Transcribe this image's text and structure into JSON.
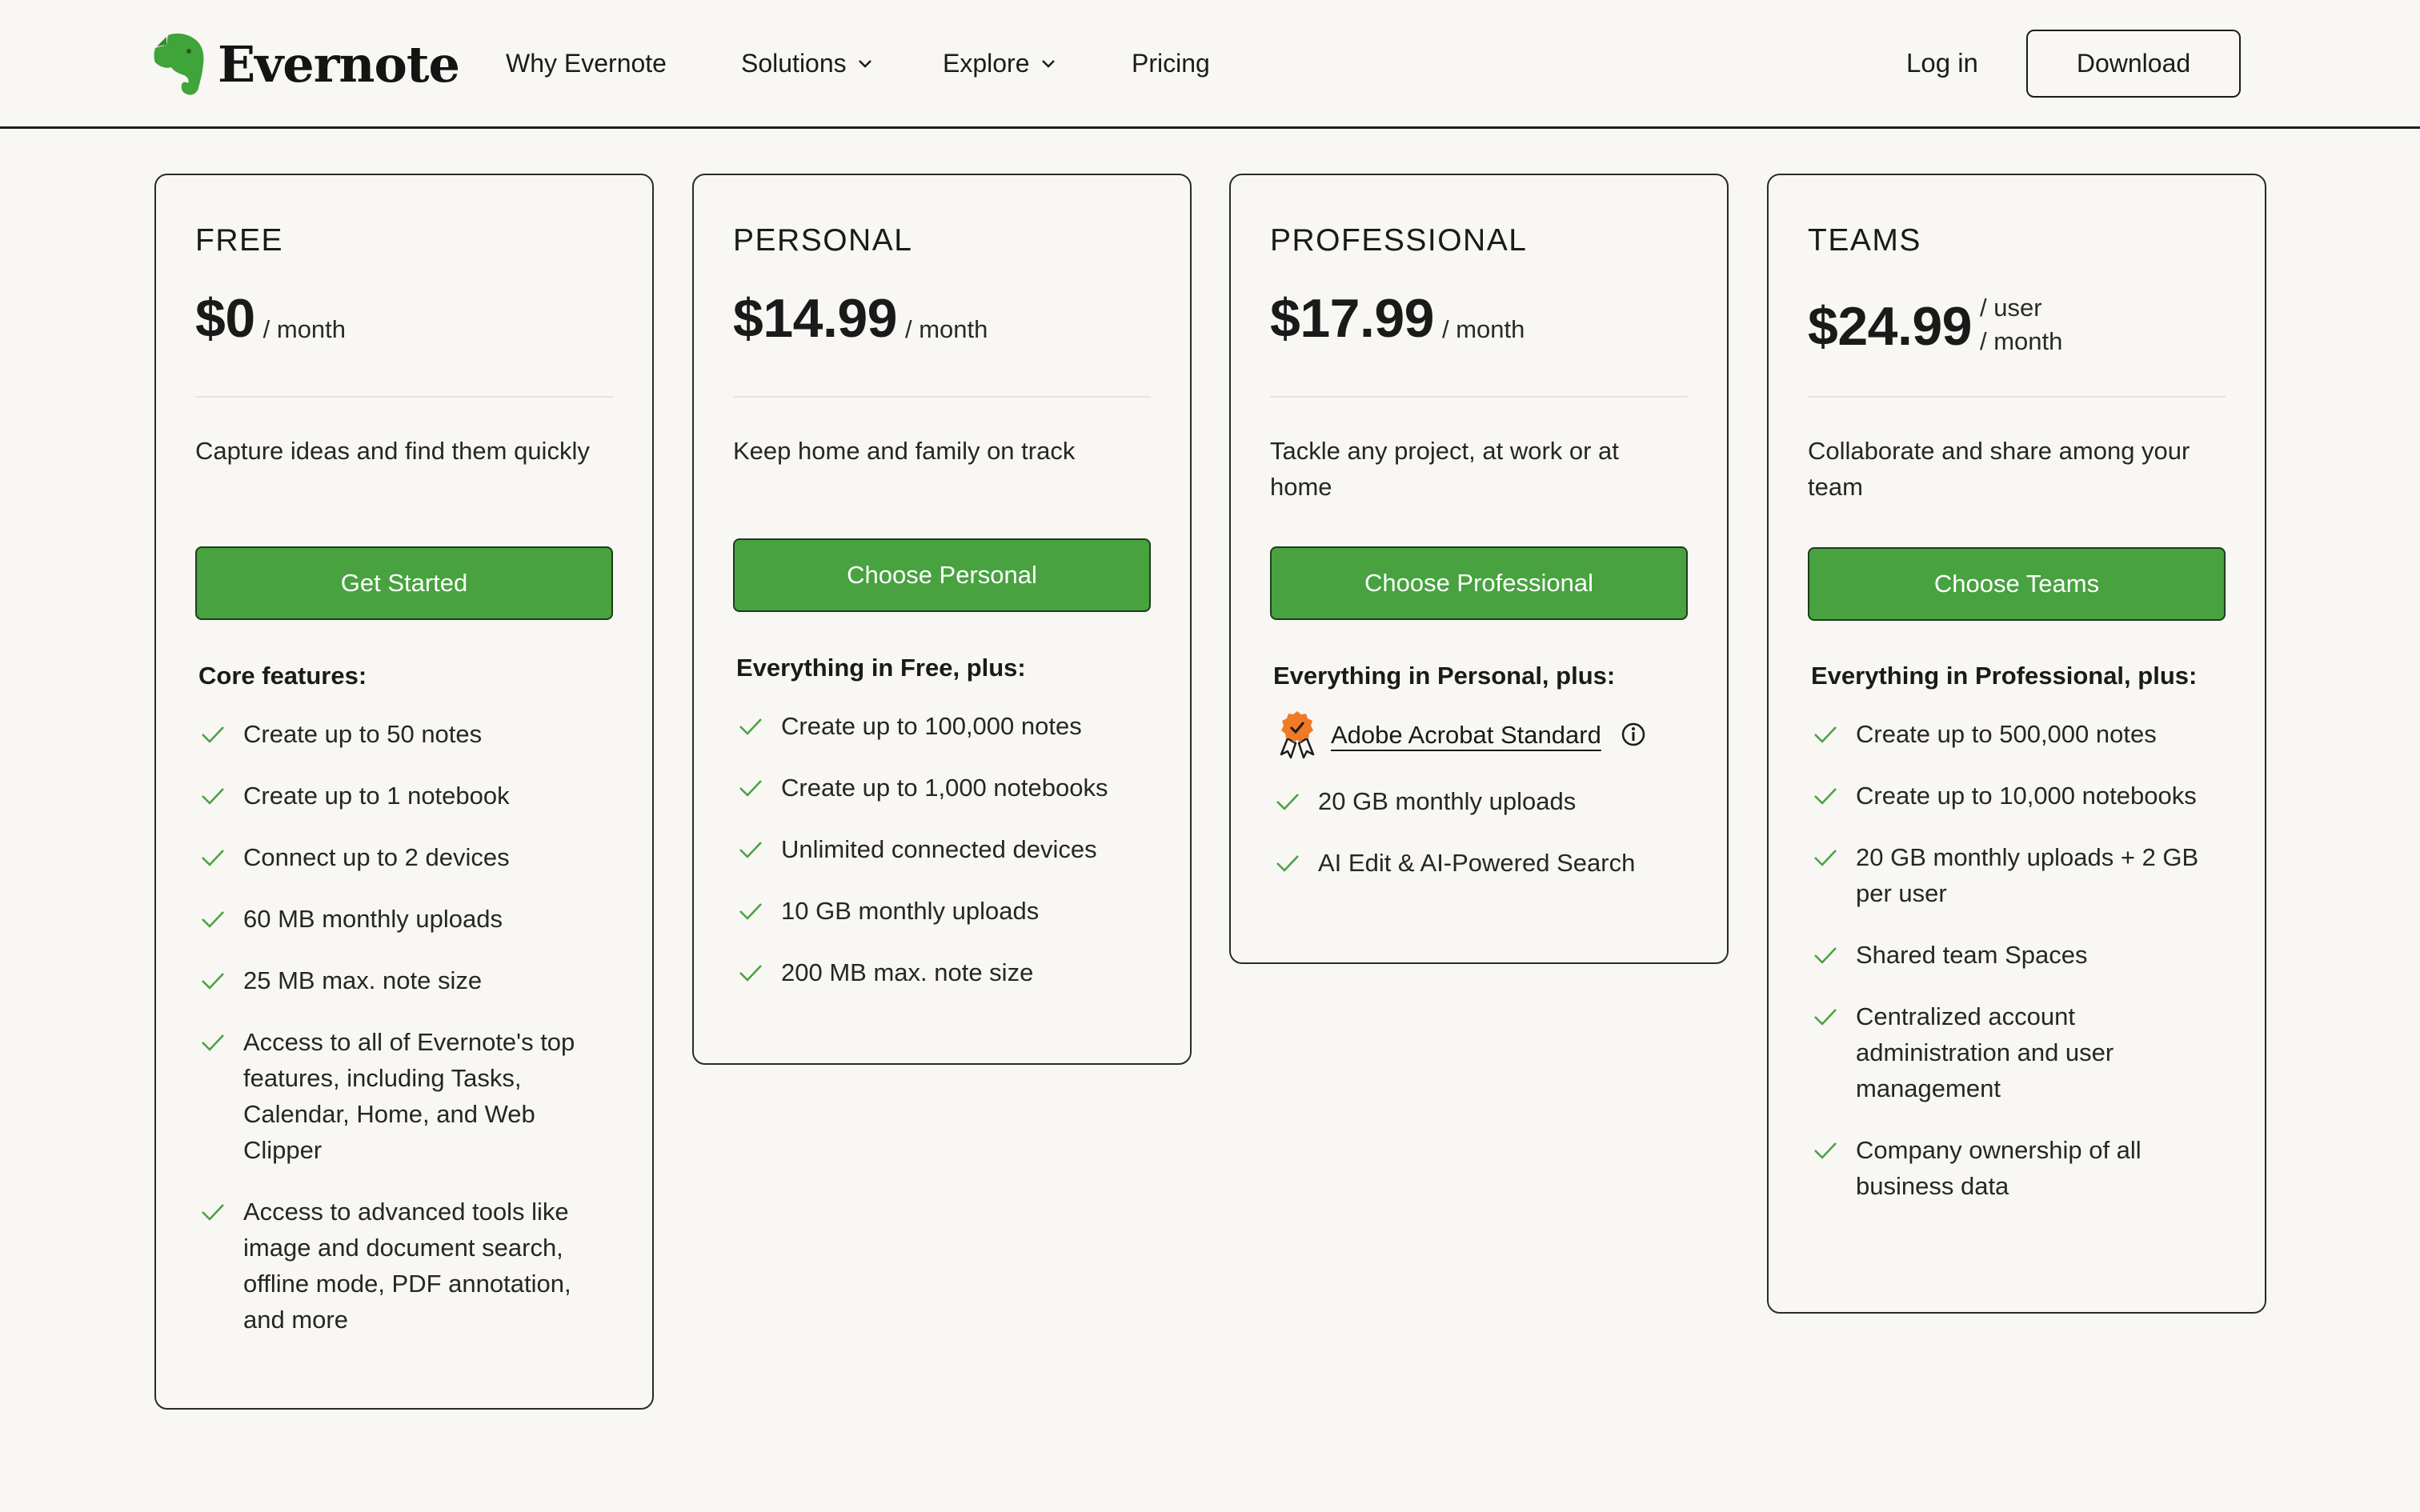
{
  "header": {
    "brand": "Evernote",
    "nav": {
      "why": "Why Evernote",
      "solutions": "Solutions",
      "explore": "Explore",
      "pricing": "Pricing"
    },
    "login": "Log in",
    "download": "Download"
  },
  "colors": {
    "accent_green": "#47a23f",
    "page_bg": "#f8f7f3",
    "badge_orange": "#f07a26"
  },
  "plans": [
    {
      "name": "FREE",
      "price": "$0",
      "period": "/ month",
      "tagline": "Capture ideas and find them quickly",
      "cta": "Get Started",
      "features_title": "Core features:",
      "features": [
        "Create up to 50 notes",
        "Create up to 1 notebook",
        "Connect up to 2 devices",
        "60 MB monthly uploads",
        "25 MB max. note size",
        "Access to all of Evernote's top features, including Tasks, Calendar, Home, and Web Clipper",
        "Access to advanced tools like image and document search, offline mode, PDF annotation, and more"
      ]
    },
    {
      "name": "PERSONAL",
      "price": "$14.99",
      "period": "/ month",
      "tagline": "Keep home and family on track",
      "cta": "Choose Personal",
      "features_title": "Everything in Free, plus:",
      "features": [
        "Create up to 100,000 notes",
        "Create up to 1,000 notebooks",
        "Unlimited connected devices",
        "10 GB monthly uploads",
        "200 MB max. note size"
      ]
    },
    {
      "name": "PROFESSIONAL",
      "price": "$17.99",
      "period": "/ month",
      "tagline": "Tackle any project, at work or at home",
      "cta": "Choose Professional",
      "features_title": "Everything in Personal, plus:",
      "addon": "Adobe Acrobat Standard",
      "features": [
        "20 GB monthly uploads",
        "AI Edit & AI-Powered Search"
      ]
    },
    {
      "name": "TEAMS",
      "price": "$24.99",
      "period_line1": "/ user",
      "period_line2": "/ month",
      "tagline": "Collaborate and share among your team",
      "cta": "Choose Teams",
      "features_title": "Everything in Professional, plus:",
      "features": [
        "Create up to 500,000 notes",
        "Create up to 10,000 notebooks",
        "20 GB monthly uploads + 2 GB per user",
        "Shared team Spaces",
        "Centralized account administration and user management",
        "Company ownership of all business data"
      ]
    }
  ]
}
